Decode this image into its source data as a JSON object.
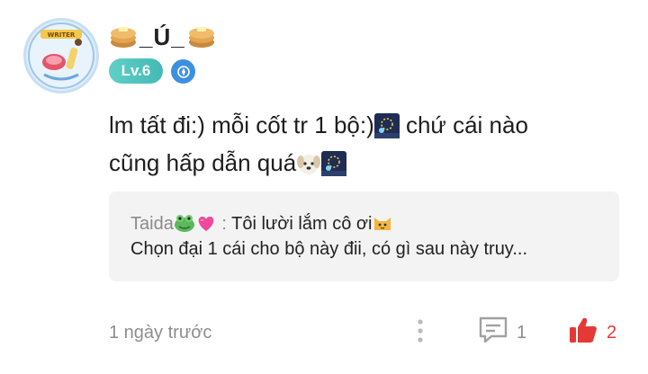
{
  "comment": {
    "username": "_Ú_",
    "level": "Lv.6",
    "text_line1": "lm tất đi:) mỗi cốt tr 1 bộ:)",
    "text_line1_after": " chứ cái nào",
    "text_line2": "cũng hấp dẫn quá",
    "quote": {
      "author": "Taida",
      "separator": " : ",
      "line1": "Tôi lười lắm cô ơi",
      "line2": "Chọn đại 1 cái cho bộ này đii, có gì sau này truy..."
    },
    "timestamp": "1 ngày trước",
    "reply_count": "1",
    "like_count": "2"
  },
  "avatar": {
    "frame_label": "WRITER"
  },
  "colors": {
    "level_badge": "#4fc4be",
    "like": "#e53935",
    "muted": "#8d8d8d",
    "quote_bg": "#f3f3f3"
  },
  "icons": [
    "pancake-emoji",
    "fireworks-emoji",
    "dog-emoji",
    "frog-emoji",
    "heart-emoji",
    "cat-emoji",
    "more-vertical-icon",
    "comment-icon",
    "thumbs-up-icon",
    "title-badge-icon"
  ]
}
